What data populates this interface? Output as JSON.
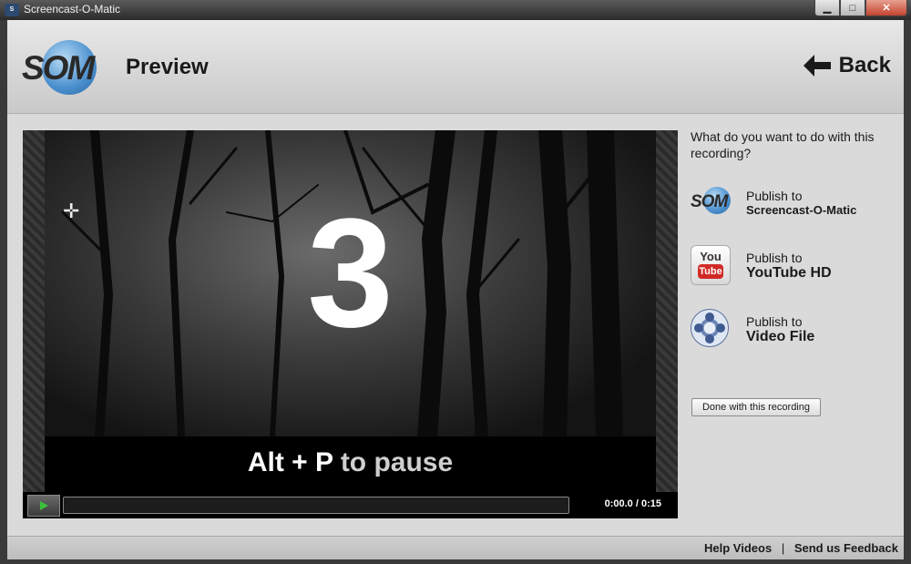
{
  "window": {
    "title": "Screencast-O-Matic",
    "minimize": "▁",
    "maximize": "□",
    "close": "✕"
  },
  "header": {
    "logo_text": "SOM",
    "page_title": "Preview",
    "back_label": "Back"
  },
  "video": {
    "countdown": "3",
    "hint_keys": "Alt + P",
    "hint_action": "to pause",
    "current_time": "0:00.0",
    "time_separator": "/",
    "total_time": "0:15",
    "progress": 0
  },
  "panel": {
    "question": "What do you want to do with this recording?",
    "options": [
      {
        "icon": "som-icon",
        "line1": "Publish to",
        "line2": "Screencast-O-Matic"
      },
      {
        "icon": "youtube-icon",
        "line1": "Publish to",
        "line2": "YouTube HD",
        "icon_you": "You",
        "icon_tube": "Tube"
      },
      {
        "icon": "film-reel-icon",
        "line1": "Publish to",
        "line2": "Video File"
      }
    ],
    "done_label": "Done with this recording"
  },
  "footer": {
    "help_videos": "Help Videos",
    "separator": "|",
    "send_feedback": "Send us Feedback"
  },
  "colors": {
    "accent": "#4a8fce",
    "play": "#39c13a",
    "youtube_red": "#d12a26"
  }
}
